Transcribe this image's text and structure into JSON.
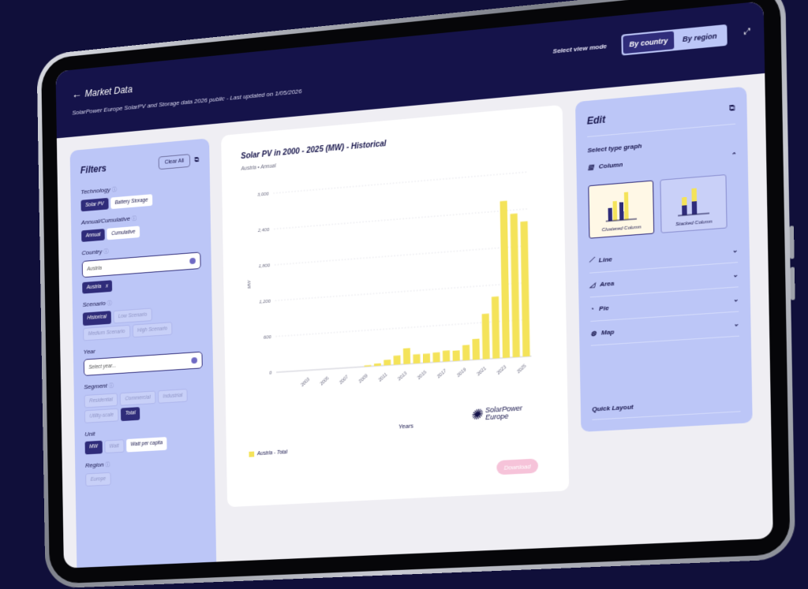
{
  "header": {
    "title": "Market Data",
    "subtitle": "SolarPower Europe SolarPV and Storage data 2026 public - Last updated on 1/05/2026",
    "view_mode_label": "Select view mode",
    "view_modes": [
      "By country",
      "By region"
    ],
    "active_view_mode": "By country"
  },
  "filters": {
    "title": "Filters",
    "clear_all": "Clear All",
    "technology": {
      "label": "Technology",
      "options": [
        "Solar PV",
        "Battery Storage"
      ],
      "selected": "Solar PV"
    },
    "annual_cumulative": {
      "label": "Annual/Cumulative",
      "options": [
        "Annual",
        "Cumulative"
      ],
      "selected": "Annual"
    },
    "country": {
      "label": "Country",
      "value": "Austria",
      "tag": "Austria",
      "tag_close": "x"
    },
    "scenario": {
      "label": "Scenario",
      "options": [
        "Historical",
        "Low Scenario",
        "Medium Scenario",
        "High Scenario"
      ],
      "selected": "Historical"
    },
    "year": {
      "label": "Year",
      "placeholder": "Select year..."
    },
    "segment": {
      "label": "Segment",
      "options": [
        "Residential",
        "Commercial",
        "Industrial",
        "Utility-scale",
        "Total"
      ],
      "selected": "Total"
    },
    "unit": {
      "label": "Unit",
      "options": [
        "MW",
        "Watt",
        "Watt per capita"
      ],
      "selected": "MW"
    },
    "region": {
      "label": "Region",
      "value": "Europe"
    }
  },
  "chart_card": {
    "title": "Solar PV in 2000 - 2025 (MW) - Historical",
    "subtitle": "Austria • Annual",
    "x_title": "Years",
    "legend": "Austria - Total",
    "logo_line1": "SolarPower",
    "logo_line2": "Europe",
    "download": "Download"
  },
  "chart_data": {
    "type": "bar",
    "xlabel": "Years",
    "ylabel": "MW",
    "ylim": [
      0,
      3000
    ],
    "yticks": [
      0,
      600,
      1200,
      1800,
      2400,
      3000
    ],
    "ytick_labels": [
      "0",
      "600",
      "1,200",
      "1,800",
      "2,400",
      "3,000"
    ],
    "xtick_labels": [
      "2003",
      "2005",
      "2007",
      "2009",
      "2011",
      "2013",
      "2015",
      "2017",
      "2019",
      "2021",
      "2023",
      "2025"
    ],
    "categories": [
      "2000",
      "2001",
      "2002",
      "2003",
      "2004",
      "2005",
      "2006",
      "2007",
      "2008",
      "2009",
      "2010",
      "2011",
      "2012",
      "2013",
      "2014",
      "2015",
      "2016",
      "2017",
      "2018",
      "2019",
      "2020",
      "2021",
      "2022",
      "2023",
      "2024",
      "2025"
    ],
    "series": [
      {
        "name": "Austria - Total",
        "color": "#f4e35a",
        "values": [
          0,
          0,
          0,
          0,
          0,
          0,
          0,
          0,
          0,
          20,
          40,
          90,
          150,
          260,
          150,
          150,
          160,
          180,
          170,
          250,
          340,
          740,
          1010,
          2560,
          2340,
          2200
        ]
      }
    ]
  },
  "edit": {
    "title": "Edit",
    "select_type": "Select type graph",
    "column": "Column",
    "graph_types": [
      "Clustered Column",
      "Stacked Column"
    ],
    "selected_graph": "Clustered Column",
    "types": [
      "Line",
      "Area",
      "Pie",
      "Map"
    ],
    "quick_layout": "Quick Layout"
  }
}
